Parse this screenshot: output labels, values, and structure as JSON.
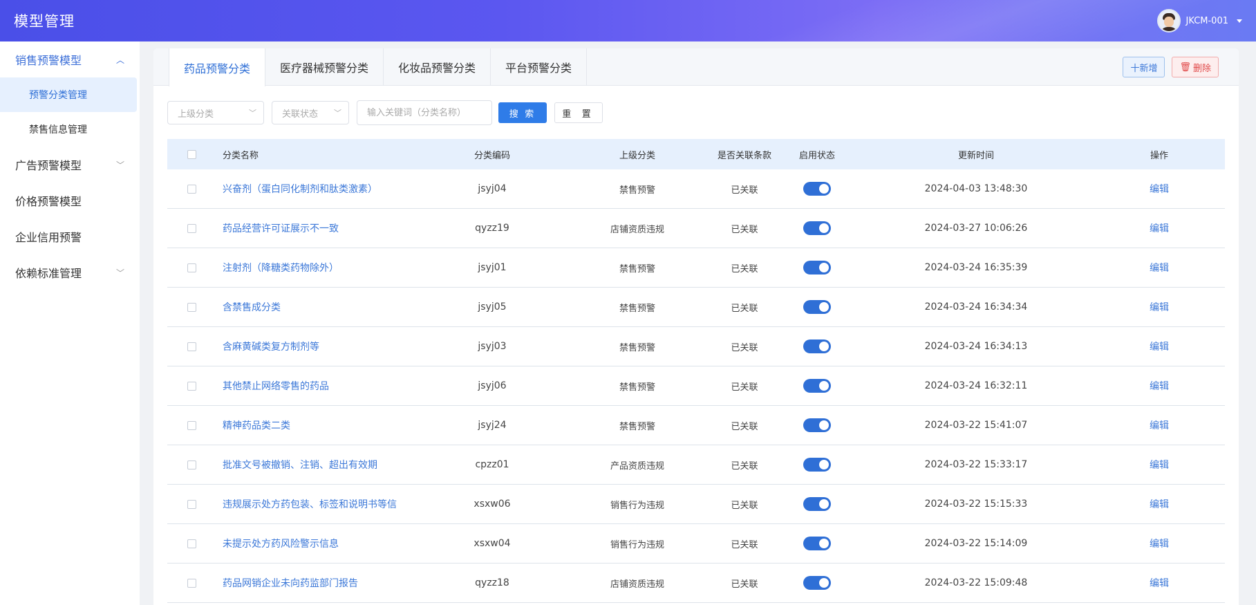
{
  "header": {
    "title": "模型管理",
    "username": "JKCM-001"
  },
  "sidebar": {
    "items": [
      {
        "label": "销售预警模型",
        "expanded": true,
        "children": [
          {
            "label": "预警分类管理",
            "active": true
          },
          {
            "label": "禁售信息管理",
            "active": false
          }
        ]
      },
      {
        "label": "广告预警模型",
        "expanded": false
      },
      {
        "label": "价格预警模型"
      },
      {
        "label": "企业信用预警"
      },
      {
        "label": "依赖标准管理",
        "expanded": false
      }
    ]
  },
  "tabs": [
    {
      "label": "药品预警分类",
      "active": true
    },
    {
      "label": "医疗器械预警分类"
    },
    {
      "label": "化妆品预警分类"
    },
    {
      "label": "平台预警分类"
    }
  ],
  "actions": {
    "add_label": "十新增",
    "delete_label": "删除"
  },
  "filters": {
    "parent_placeholder": "上级分类",
    "assoc_placeholder": "关联状态",
    "keyword_placeholder": "输入关键词（分类名称）",
    "search_label": "搜 索",
    "reset_label": "重 置"
  },
  "table": {
    "columns": [
      "分类名称",
      "分类编码",
      "上级分类",
      "是否关联条款",
      "启用状态",
      "更新时间",
      "操作"
    ],
    "rows": [
      {
        "name": "兴奋剂（蛋白同化制剂和肽类激素）",
        "code": "jsyj04",
        "parent": "禁售预警",
        "assoc": "已关联",
        "enabled": true,
        "time": "2024-04-03 13:48:30",
        "op": "编辑"
      },
      {
        "name": "药品经营许可证展示不一致",
        "code": "qyzz19",
        "parent": "店铺资质违规",
        "assoc": "已关联",
        "enabled": true,
        "time": "2024-03-27 10:06:26",
        "op": "编辑"
      },
      {
        "name": "注射剂（降糖类药物除外）",
        "code": "jsyj01",
        "parent": "禁售预警",
        "assoc": "已关联",
        "enabled": true,
        "time": "2024-03-24 16:35:39",
        "op": "编辑"
      },
      {
        "name": "含禁售成分类",
        "code": "jsyj05",
        "parent": "禁售预警",
        "assoc": "已关联",
        "enabled": true,
        "time": "2024-03-24 16:34:34",
        "op": "编辑"
      },
      {
        "name": "含麻黄碱类复方制剂等",
        "code": "jsyj03",
        "parent": "禁售预警",
        "assoc": "已关联",
        "enabled": true,
        "time": "2024-03-24 16:34:13",
        "op": "编辑"
      },
      {
        "name": "其他禁止网络零售的药品",
        "code": "jsyj06",
        "parent": "禁售预警",
        "assoc": "已关联",
        "enabled": true,
        "time": "2024-03-24 16:32:11",
        "op": "编辑"
      },
      {
        "name": "精神药品类二类",
        "code": "jsyj24",
        "parent": "禁售预警",
        "assoc": "已关联",
        "enabled": true,
        "time": "2024-03-22 15:41:07",
        "op": "编辑"
      },
      {
        "name": "批准文号被撤销、注销、超出有效期",
        "code": "cpzz01",
        "parent": "产品资质违规",
        "assoc": "已关联",
        "enabled": true,
        "time": "2024-03-22 15:33:17",
        "op": "编辑"
      },
      {
        "name": "违规展示处方药包装、标签和说明书等信",
        "code": "xsxw06",
        "parent": "销售行为违规",
        "assoc": "已关联",
        "enabled": true,
        "time": "2024-03-22 15:15:33",
        "op": "编辑"
      },
      {
        "name": "未提示处方药风险警示信息",
        "code": "xsxw04",
        "parent": "销售行为违规",
        "assoc": "已关联",
        "enabled": true,
        "time": "2024-03-22 15:14:09",
        "op": "编辑"
      },
      {
        "name": "药品网销企业未向药监部门报告",
        "code": "qyzz18",
        "parent": "店铺资质违规",
        "assoc": "已关联",
        "enabled": true,
        "time": "2024-03-22 15:09:48",
        "op": "编辑"
      }
    ]
  },
  "colors": {
    "accent": "#2f6fd6",
    "header_start": "#4a4fe8",
    "header_end": "#6a7af3",
    "danger": "#e04848"
  }
}
